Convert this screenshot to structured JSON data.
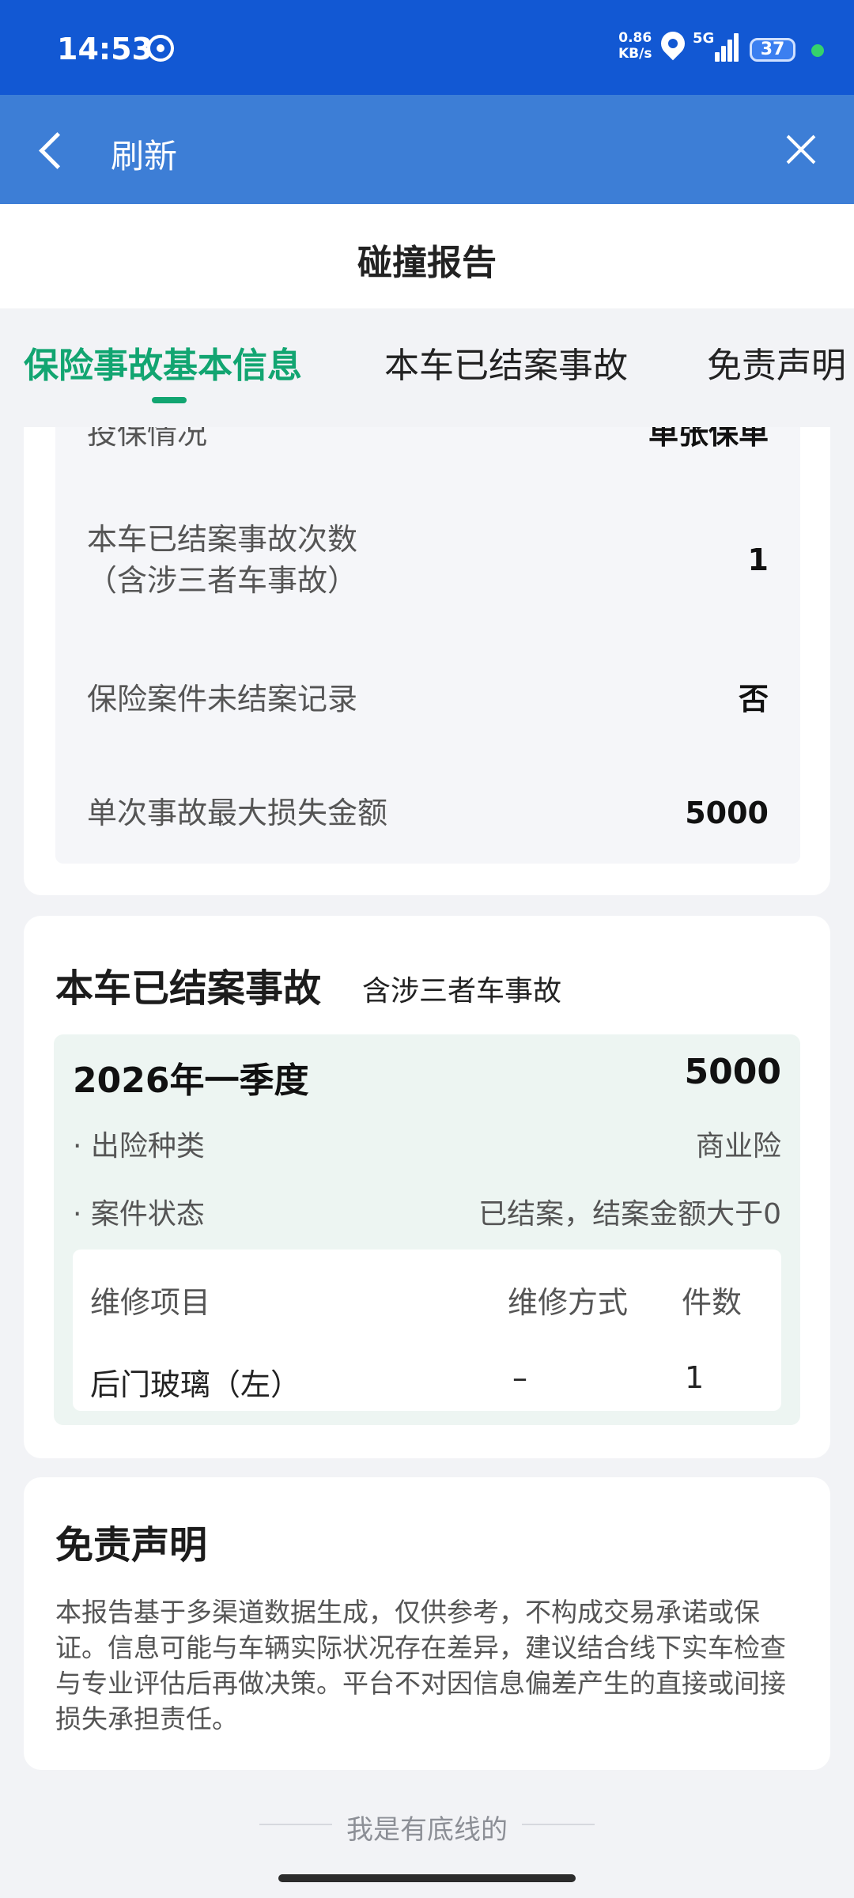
{
  "status_bar": {
    "time": "14:53",
    "speed_value": "0.86",
    "speed_unit": "KB/s",
    "network": "5G",
    "battery": "37",
    "colors": {
      "background": "#1258d3",
      "dot": "#35d26c"
    },
    "icons": [
      "app-icon",
      "location-icon",
      "signal-icon",
      "battery-icon"
    ]
  },
  "nav": {
    "title": "刷新",
    "icons": [
      "back-icon",
      "close-icon"
    ],
    "background": "#3d7ed6"
  },
  "page": {
    "title": "碰撞报告"
  },
  "tabs": [
    {
      "label": "保险事故基本信息",
      "active": true
    },
    {
      "label": "本车已结案事故",
      "active": false
    },
    {
      "label": "免责声明",
      "active": false
    }
  ],
  "accent_color": "#12a571",
  "basic_info": {
    "rows": [
      {
        "label": "投保情况",
        "value": "单张保单"
      },
      {
        "label": "本车已结案事故次数",
        "label2": "（含涉三者车事故）",
        "value": "1"
      },
      {
        "label": "保险案件未结案记录",
        "value": "否"
      },
      {
        "label": "单次事故最大损失金额",
        "value": "5000"
      }
    ]
  },
  "settled_claims": {
    "title": "本车已结案事故",
    "subtitle": "含涉三者车事故",
    "claims": [
      {
        "period": "2026年一季度",
        "amount": "5000",
        "details": [
          {
            "label": "· 出险种类",
            "value": "商业险"
          },
          {
            "label": "· 案件状态",
            "value": "已结案，结案金额大于0"
          }
        ],
        "repair_headers": [
          "维修项目",
          "维修方式",
          "件数"
        ],
        "repair_items": [
          {
            "item": "后门玻璃（左）",
            "method": "–",
            "count": "1"
          }
        ]
      }
    ]
  },
  "disclaimer": {
    "title": "免责声明",
    "body": "本报告基于多渠道数据生成，仅供参考，不构成交易承诺或保证。信息可能与车辆实际状况存在差异，建议结合线下实车检查与专业评估后再做决策。平台不对因信息偏差产生的直接或间接损失承担责任。"
  },
  "footer": {
    "text": "我是有底线的"
  }
}
